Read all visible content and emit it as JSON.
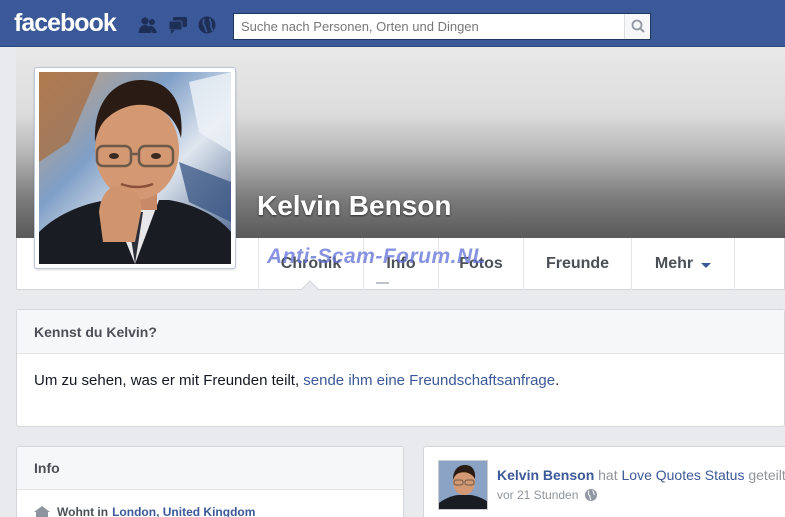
{
  "topbar": {
    "logo": "facebook",
    "search_placeholder": "Suche nach Personen, Orten und Dingen",
    "icons": [
      "friend-requests-icon",
      "messages-icon",
      "notifications-globe-icon",
      "search-icon"
    ]
  },
  "profile": {
    "name": "Kelvin Benson",
    "photo_description": "man-with-glasses-portrait"
  },
  "tabs": [
    {
      "label": "Chronik",
      "active": true
    },
    {
      "label": "Info"
    },
    {
      "label": "Fotos"
    },
    {
      "label": "Freunde"
    },
    {
      "label": "Mehr",
      "has_caret": true
    }
  ],
  "watermark": "Anti-Scam-Forum.NL",
  "know_card": {
    "title": "Kennst du Kelvin?",
    "text_before": "Um zu sehen, was er mit Freunden teilt, ",
    "link": "sende ihm eine Freundschaftsanfrage",
    "text_after": "."
  },
  "info_card": {
    "title": "Info",
    "row_prefix": "Wohnt in",
    "row_link": "London, United Kingdom"
  },
  "post": {
    "author": "Kelvin Benson",
    "verb": "hat",
    "page": "Love Quotes Status",
    "verb2": "geteilt.",
    "time": "vor 21 Stunden"
  },
  "colors": {
    "brand": "#3b5998",
    "background": "#e9eaed",
    "link": "#3b5998"
  }
}
